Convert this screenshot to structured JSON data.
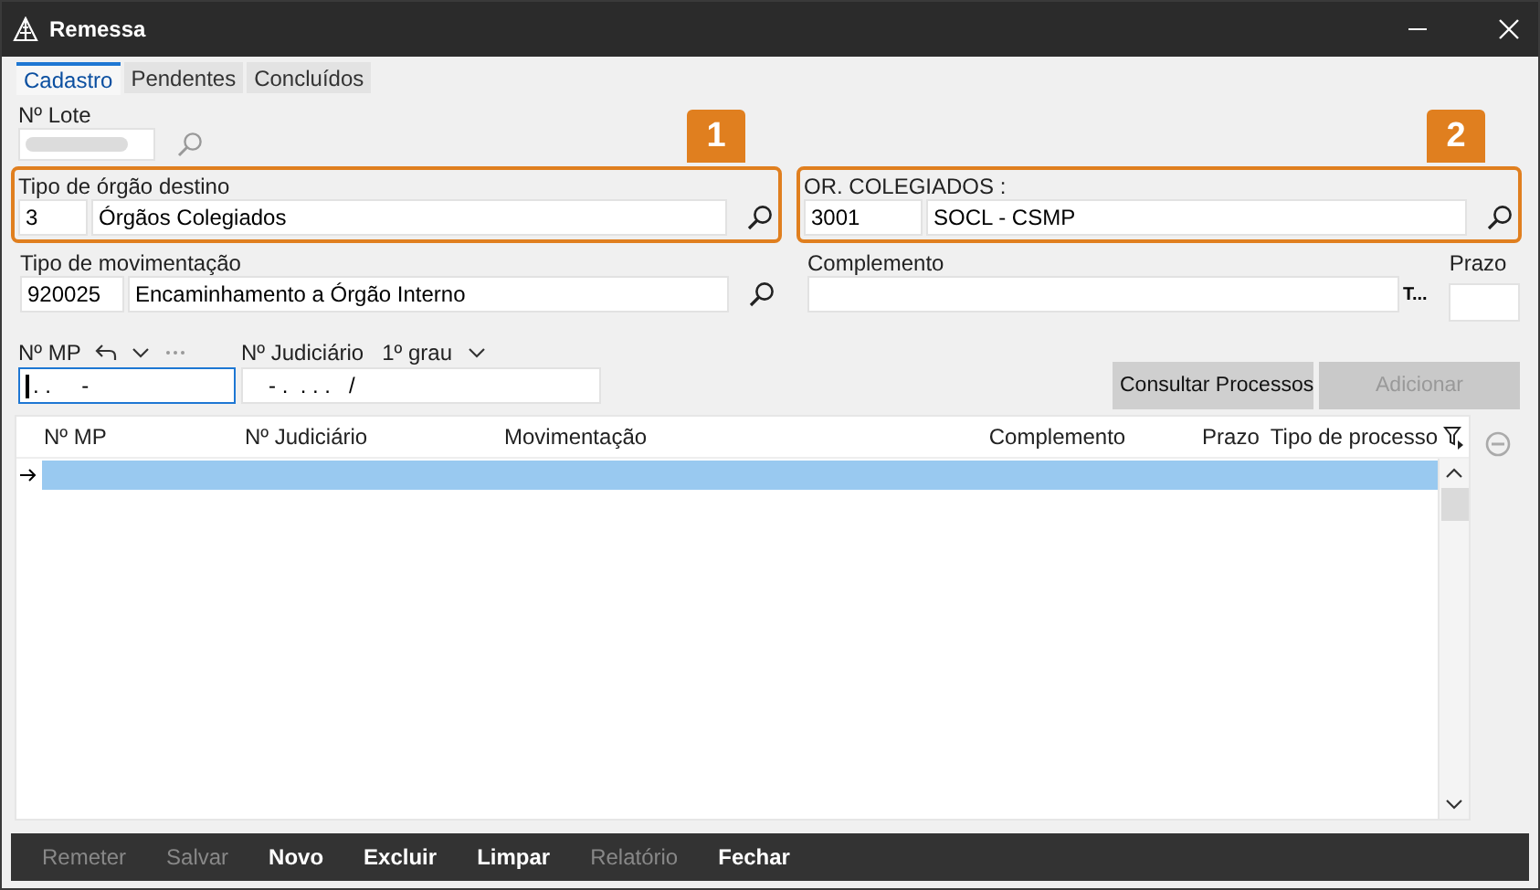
{
  "window": {
    "title": "Remessa"
  },
  "tabs": [
    {
      "label": "Cadastro",
      "selected": true
    },
    {
      "label": "Pendentes",
      "selected": false
    },
    {
      "label": "Concluídos",
      "selected": false
    }
  ],
  "lote": {
    "label": "Nº Lote"
  },
  "tipo_orgao": {
    "label": "Tipo de órgão destino",
    "code": "3",
    "value": "Órgãos Colegiados",
    "callout": "1"
  },
  "colegiados": {
    "label": "OR. COLEGIADOS :",
    "code": "3001",
    "value": "SOCL - CSMP",
    "callout": "2"
  },
  "movimentacao": {
    "label": "Tipo de movimentação",
    "code": "920025",
    "value": "Encaminhamento a Órgão Interno"
  },
  "complemento": {
    "label": "Complemento",
    "suffix": "T..."
  },
  "prazo": {
    "label": "Prazo"
  },
  "mp": {
    "label": "Nº MP",
    "value": ". .     -",
    "focused": true
  },
  "judiciario": {
    "label": "Nº Judiciário",
    "instance": "1º grau",
    "value": "- .  . . .   /"
  },
  "actions": [
    {
      "label": "Consultar Processos",
      "disabled": false
    },
    {
      "label": "Adicionar",
      "disabled": true
    }
  ],
  "grid": {
    "columns": [
      "Nº MP",
      "Nº Judiciário",
      "Movimentação",
      "Complemento",
      "Prazo",
      "Tipo de processo"
    ],
    "rows": [
      {
        "selected": true
      }
    ]
  },
  "footer_buttons": [
    {
      "label": "Remeter",
      "disabled": true
    },
    {
      "label": "Salvar",
      "disabled": true
    },
    {
      "label": "Novo",
      "disabled": false
    },
    {
      "label": "Excluir",
      "disabled": false
    },
    {
      "label": "Limpar",
      "disabled": false
    },
    {
      "label": "Relatório",
      "disabled": true
    },
    {
      "label": "Fechar",
      "disabled": false
    }
  ]
}
